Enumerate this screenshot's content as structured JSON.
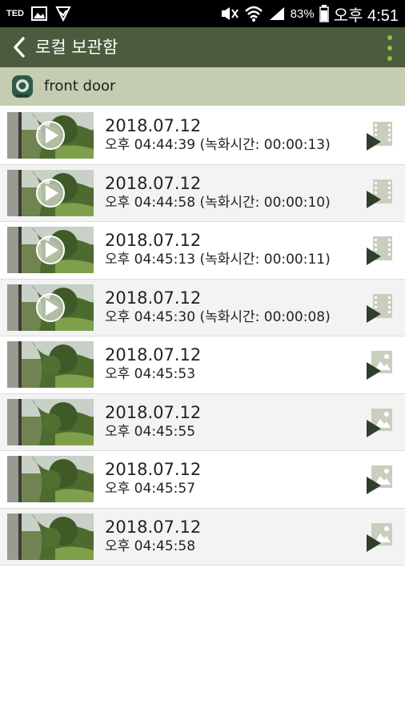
{
  "status_bar": {
    "carrier": "TED",
    "battery": "83%",
    "time": "오후 4:51"
  },
  "app_bar": {
    "title": "로컬 보관함"
  },
  "camera": {
    "name": "front door"
  },
  "colors": {
    "app_bar": "#4b5b3d",
    "camera_header": "#c4ccb2",
    "accent_green": "#8cc43f",
    "media_icon_dark": "#2e3f2b",
    "media_icon_light": "#c9cfbd"
  },
  "recordings": [
    {
      "date": "2018.07.12",
      "time": "오후 04:44:39 (녹화시간: 00:00:13)",
      "type": "video",
      "icon": "video-film-icon"
    },
    {
      "date": "2018.07.12",
      "time": "오후 04:44:58 (녹화시간: 00:00:10)",
      "type": "video",
      "icon": "video-film-icon"
    },
    {
      "date": "2018.07.12",
      "time": "오후 04:45:13 (녹화시간: 00:00:11)",
      "type": "video",
      "icon": "video-film-icon"
    },
    {
      "date": "2018.07.12",
      "time": "오후 04:45:30 (녹화시간: 00:00:08)",
      "type": "video",
      "icon": "video-film-icon"
    },
    {
      "date": "2018.07.12",
      "time": "오후 04:45:53",
      "type": "image",
      "icon": "image-icon"
    },
    {
      "date": "2018.07.12",
      "time": "오후 04:45:55",
      "type": "image",
      "icon": "image-icon"
    },
    {
      "date": "2018.07.12",
      "time": "오후 04:45:57",
      "type": "image",
      "icon": "image-icon"
    },
    {
      "date": "2018.07.12",
      "time": "오후 04:45:58",
      "type": "image",
      "icon": "image-icon"
    }
  ]
}
